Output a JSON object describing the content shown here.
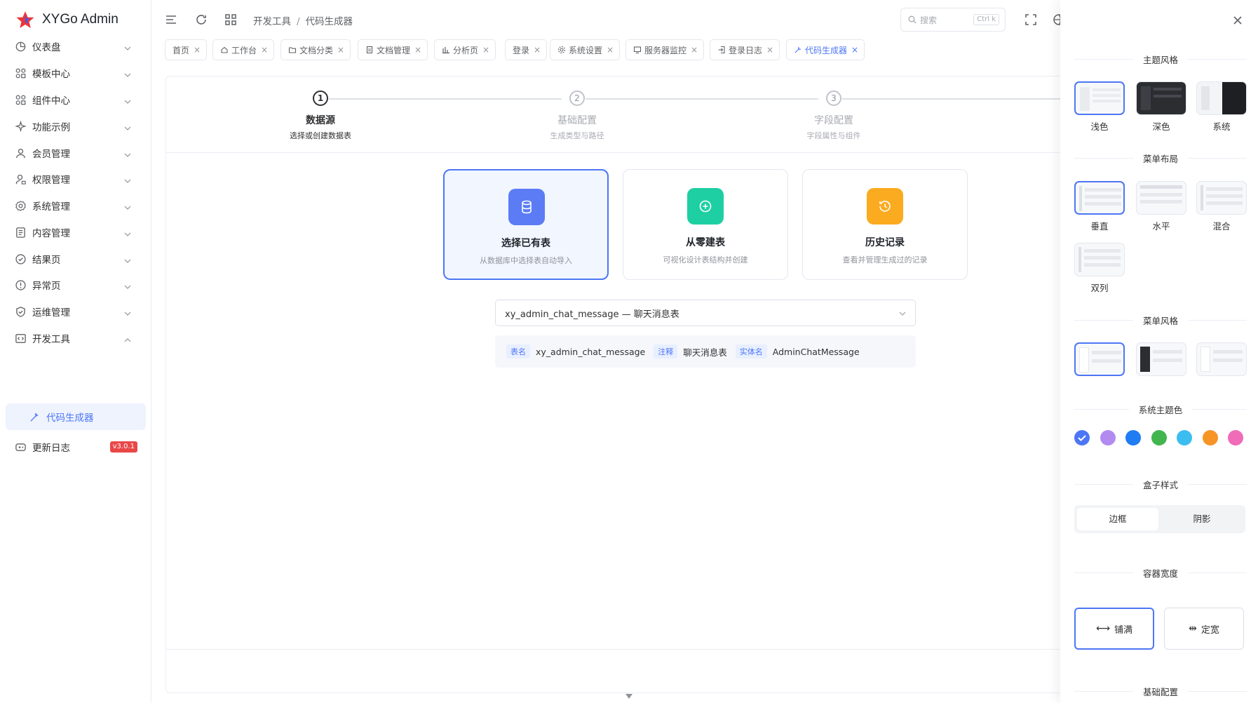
{
  "app": {
    "title": "XYGo Admin"
  },
  "sidebar": {
    "items": [
      {
        "label": "仪表盘",
        "icon": "dashboard-icon"
      },
      {
        "label": "模板中心",
        "icon": "grid-icon"
      },
      {
        "label": "组件中心",
        "icon": "grid-icon"
      },
      {
        "label": "功能示例",
        "icon": "sparkle-icon"
      },
      {
        "label": "会员管理",
        "icon": "user-icon"
      },
      {
        "label": "权限管理",
        "icon": "user-lock-icon"
      },
      {
        "label": "系统管理",
        "icon": "gear-icon"
      },
      {
        "label": "内容管理",
        "icon": "document-icon"
      },
      {
        "label": "结果页",
        "icon": "check-circle-icon"
      },
      {
        "label": "异常页",
        "icon": "warning-circle-icon"
      },
      {
        "label": "运维管理",
        "icon": "shield-check-icon"
      },
      {
        "label": "开发工具",
        "icon": "code-icon"
      }
    ],
    "sub_item": {
      "label": "代码生成器"
    },
    "changelog": {
      "label": "更新日志",
      "badge": "v3.0.1"
    }
  },
  "header": {
    "breadcrumb": [
      "开发工具",
      "代码生成器"
    ],
    "search_placeholder": "搜索",
    "search_kbd": "Ctrl k"
  },
  "tabs": [
    {
      "label": "首页",
      "icon": ""
    },
    {
      "label": "工作台",
      "icon": "home-icon"
    },
    {
      "label": "文档分类",
      "icon": "folder-icon"
    },
    {
      "label": "文档管理",
      "icon": "file-icon"
    },
    {
      "label": "分析页",
      "icon": "bar-chart-icon"
    },
    {
      "label": "登录",
      "icon": ""
    },
    {
      "label": "系统设置",
      "icon": "gear-icon"
    },
    {
      "label": "服务器监控",
      "icon": "monitor-icon"
    },
    {
      "label": "登录日志",
      "icon": "login-icon"
    },
    {
      "label": "代码生成器",
      "icon": "magic-icon"
    }
  ],
  "steps": [
    {
      "num": "1",
      "title": "数据源",
      "desc": "选择或创建数据表",
      "active": true
    },
    {
      "num": "2",
      "title": "基础配置",
      "desc": "生成类型与路径",
      "active": false
    },
    {
      "num": "3",
      "title": "字段配置",
      "desc": "字段属性与组件",
      "active": false
    }
  ],
  "cards": [
    {
      "title": "选择已有表",
      "desc": "从数据库中选择表自动导入",
      "color": "#5b7cf5"
    },
    {
      "title": "从零建表",
      "desc": "可视化设计表结构并创建",
      "color": "#1ecfa3"
    },
    {
      "title": "历史记录",
      "desc": "查看并管理生成过的记录",
      "color": "#fbab1f"
    }
  ],
  "table_select": {
    "value": "xy_admin_chat_message — 聊天消息表"
  },
  "table_info": {
    "name_tag": "表名",
    "name": "xy_admin_chat_message",
    "comment_tag": "注释",
    "comment": "聊天消息表",
    "entity_tag": "实体名",
    "entity": "AdminChatMessage"
  },
  "drawer": {
    "theme_section": "主题风格",
    "themes": [
      "浅色",
      "深色",
      "系统"
    ],
    "layout_section": "菜单布局",
    "layouts": [
      "垂直",
      "水平",
      "混合",
      "双列"
    ],
    "menu_style_section": "菜单风格",
    "color_section": "系统主题色",
    "colors": [
      "#4d76f5",
      "#b38bf0",
      "#1f7cf3",
      "#43b54f",
      "#3bbdf0",
      "#f69426",
      "#f06bb8"
    ],
    "box_section": "盒子样式",
    "box_options": [
      "边框",
      "阴影"
    ],
    "width_section": "容器宽度",
    "width_options": [
      "铺满",
      "定宽"
    ],
    "basic_section": "基础配置"
  }
}
